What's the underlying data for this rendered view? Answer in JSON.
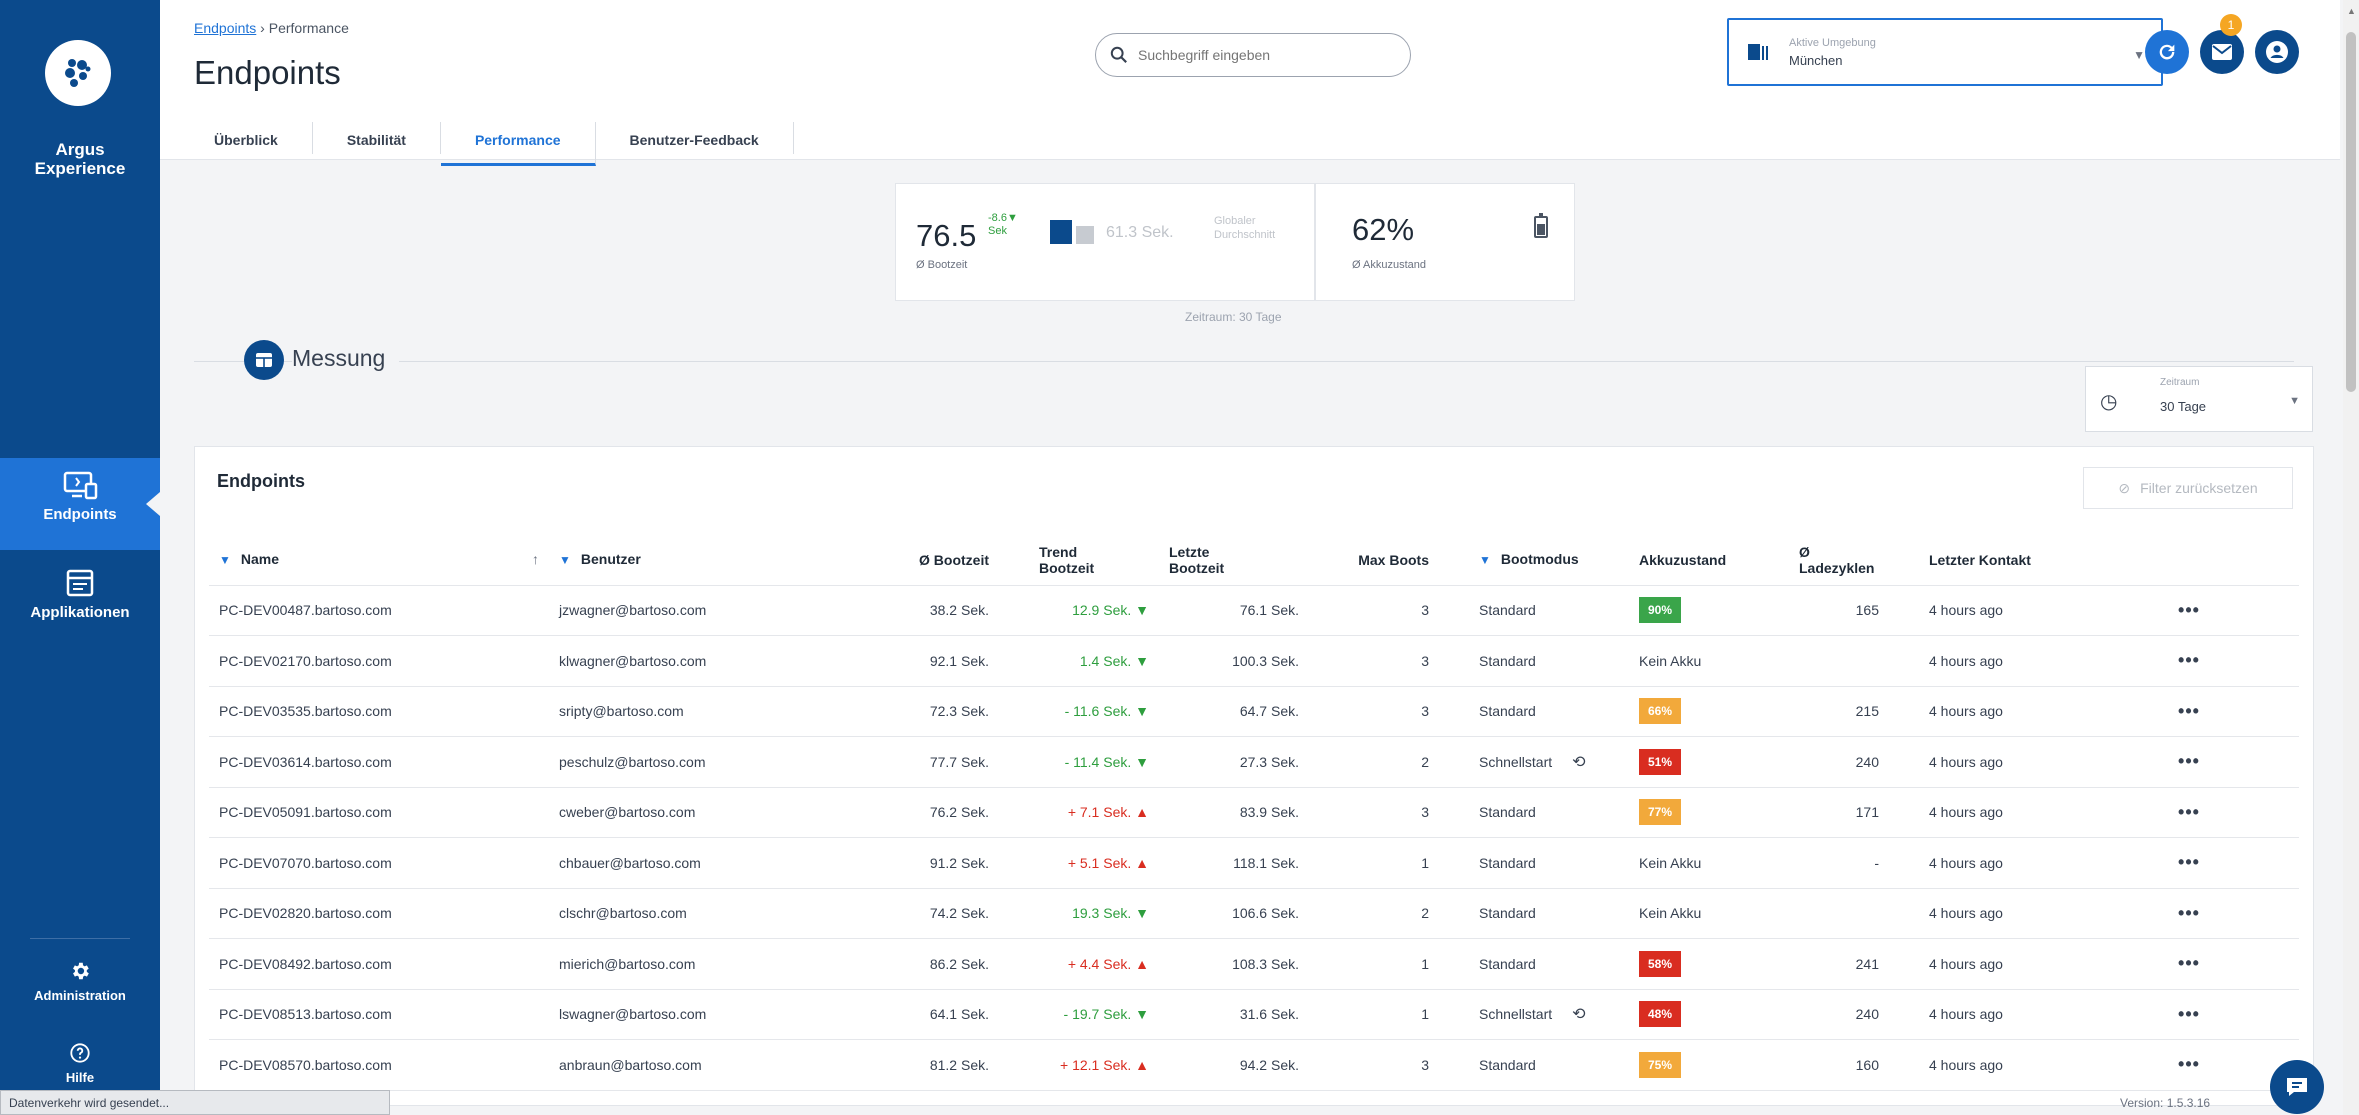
{
  "sidebar": {
    "brand": "Argus\nExperience",
    "brand_line1": "Argus",
    "brand_line2": "Experience",
    "items": [
      {
        "label": "Endpoints",
        "icon": "desktop-icon"
      },
      {
        "label": "Applikationen",
        "icon": "app-window-icon"
      },
      {
        "label": "Administration",
        "icon": "gear-icon"
      },
      {
        "label": "Hilfe",
        "icon": "help-icon"
      }
    ]
  },
  "header": {
    "breadcrumb_link": "Endpoints",
    "breadcrumb_current": "Performance",
    "title": "Endpoints",
    "tabs": [
      "Überblick",
      "Stabilität",
      "Performance",
      "Benutzer-Feedback"
    ],
    "search_placeholder": "Suchbegriff eingeben",
    "env_label": "Aktive Umgebung",
    "env_value": "München",
    "notification_count": "1"
  },
  "kpi": {
    "boot_value": "76.5",
    "boot_unit": "Sek",
    "boot_delta": "-8.6▼",
    "boot_label": "Ø Bootzeit",
    "global_value": "61.3 Sek.",
    "global_label_1": "Globaler",
    "global_label_2": "Durchschnitt",
    "battery_value": "62%",
    "battery_label": "Ø Akkuzustand",
    "period_text": "Zeitraum: 30 Tage"
  },
  "section": {
    "title": "Messung",
    "zeitraum_label": "Zeitraum",
    "zeitraum_value": "30 Tage"
  },
  "table": {
    "title": "Endpoints",
    "reset_label": "Filter zurücksetzen",
    "headers": {
      "name": "Name",
      "user": "Benutzer",
      "avg_boot": "Ø Bootzeit",
      "trend_1": "Trend",
      "trend_2": "Bootzeit",
      "last_1": "Letzte",
      "last_2": "Bootzeit",
      "max_boots": "Max Boots",
      "boot_mode": "Bootmodus",
      "battery": "Akkuzustand",
      "cycles_1": "Ø",
      "cycles_2": "Ladezyklen",
      "last_contact": "Letzter Kontakt"
    },
    "rows": [
      {
        "name": "PC-DEV00487.bartoso.com",
        "user": "jzwagner@bartoso.com",
        "avg": "38.2 Sek.",
        "trend": "12.9 Sek. ▼",
        "trend_dir": "down",
        "last": "76.1 Sek.",
        "max": "3",
        "mode": "Standard",
        "battery": "90%",
        "battery_color": "#3aa54a",
        "cycles": "165",
        "contact": "4 hours ago"
      },
      {
        "name": "PC-DEV02170.bartoso.com",
        "user": "klwagner@bartoso.com",
        "avg": "92.1 Sek.",
        "trend": "1.4 Sek. ▼",
        "trend_dir": "down",
        "last": "100.3 Sek.",
        "max": "3",
        "mode": "Standard",
        "battery": "Kein Akku",
        "battery_color": "",
        "cycles": "",
        "contact": "4 hours ago"
      },
      {
        "name": "PC-DEV03535.bartoso.com",
        "user": "sripty@bartoso.com",
        "avg": "72.3 Sek.",
        "trend": "- 11.6 Sek. ▼",
        "trend_dir": "down",
        "last": "64.7 Sek.",
        "max": "3",
        "mode": "Standard",
        "battery": "66%",
        "battery_color": "#f2a93b",
        "cycles": "215",
        "contact": "4 hours ago"
      },
      {
        "name": "PC-DEV03614.bartoso.com",
        "user": "peschulz@bartoso.com",
        "avg": "77.7 Sek.",
        "trend": "- 11.4 Sek. ▼",
        "trend_dir": "down",
        "last": "27.3 Sek.",
        "max": "2",
        "mode": "Schnellstart",
        "battery": "51%",
        "battery_color": "#d92d20",
        "cycles": "240",
        "contact": "4 hours ago"
      },
      {
        "name": "PC-DEV05091.bartoso.com",
        "user": "cweber@bartoso.com",
        "avg": "76.2 Sek.",
        "trend": "+ 7.1 Sek. ▲",
        "trend_dir": "up",
        "last": "83.9 Sek.",
        "max": "3",
        "mode": "Standard",
        "battery": "77%",
        "battery_color": "#f2a93b",
        "cycles": "171",
        "contact": "4 hours ago"
      },
      {
        "name": "PC-DEV07070.bartoso.com",
        "user": "chbauer@bartoso.com",
        "avg": "91.2 Sek.",
        "trend": "+ 5.1 Sek. ▲",
        "trend_dir": "up",
        "last": "118.1 Sek.",
        "max": "1",
        "mode": "Standard",
        "battery": "Kein Akku",
        "battery_color": "",
        "cycles": "-",
        "contact": "4 hours ago"
      },
      {
        "name": "PC-DEV02820.bartoso.com",
        "user": "clschr@bartoso.com",
        "avg": "74.2 Sek.",
        "trend": "19.3 Sek. ▼",
        "trend_dir": "down",
        "last": "106.6 Sek.",
        "max": "2",
        "mode": "Standard",
        "battery": "Kein Akku",
        "battery_color": "",
        "cycles": "",
        "contact": "4 hours ago"
      },
      {
        "name": "PC-DEV08492.bartoso.com",
        "user": "mierich@bartoso.com",
        "avg": "86.2 Sek.",
        "trend": "+ 4.4 Sek. ▲",
        "trend_dir": "up",
        "last": "108.3 Sek.",
        "max": "1",
        "mode": "Standard",
        "battery": "58%",
        "battery_color": "#d92d20",
        "cycles": "241",
        "contact": "4 hours ago"
      },
      {
        "name": "PC-DEV08513.bartoso.com",
        "user": "lswagner@bartoso.com",
        "avg": "64.1 Sek.",
        "trend": "- 19.7 Sek. ▼",
        "trend_dir": "down",
        "last": "31.6 Sek.",
        "max": "1",
        "mode": "Schnellstart",
        "battery": "48%",
        "battery_color": "#d92d20",
        "cycles": "240",
        "contact": "4 hours ago"
      },
      {
        "name": "PC-DEV08570.bartoso.com",
        "user": "anbraun@bartoso.com",
        "avg": "81.2 Sek.",
        "trend": "+ 12.1 Sek. ▲",
        "trend_dir": "up",
        "last": "94.2 Sek.",
        "max": "3",
        "mode": "Standard",
        "battery": "75%",
        "battery_color": "#f2a93b",
        "cycles": "160",
        "contact": "4 hours ago"
      }
    ]
  },
  "footer": {
    "status_text": "Datenverkehr wird gesendet...",
    "version": "Version: 1.5.3.16"
  },
  "colors": {
    "sidebar": "#0b4a8c",
    "accent": "#1f73d6",
    "up": "#d92d20",
    "down": "#2e9e3e"
  }
}
